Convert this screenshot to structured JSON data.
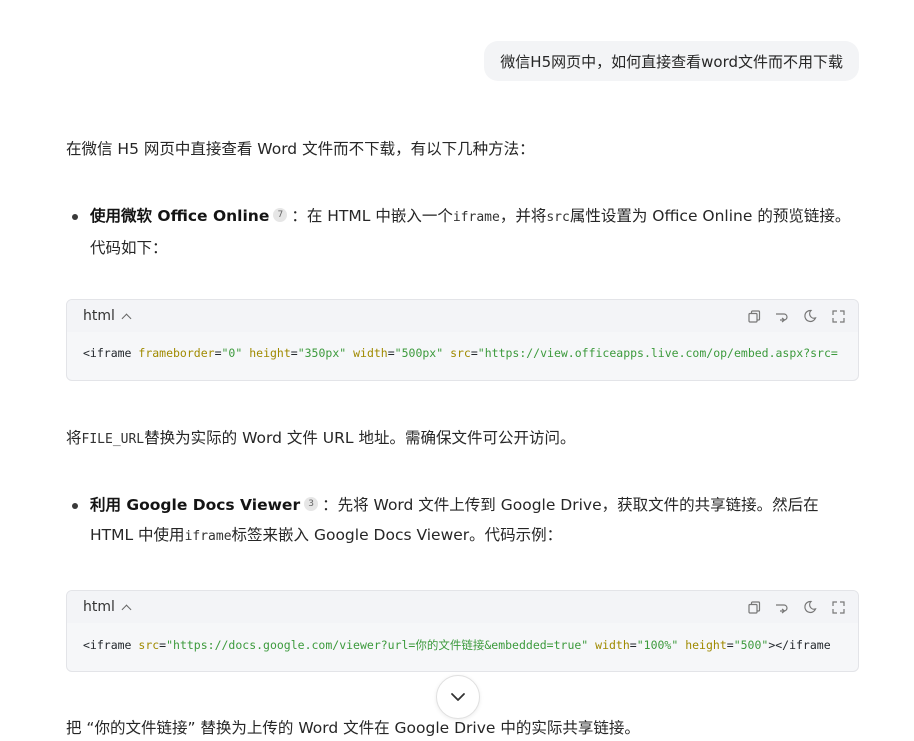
{
  "user_message": "微信H5网页中，如何直接查看word文件而不用下载",
  "intro": "在微信 H5 网页中直接查看 Word 文件而不下载，有以下几种方法：",
  "bullets": [
    {
      "title": "使用微软 Office Online",
      "cite": "7",
      "text_a": "：在 HTML 中嵌入一个",
      "code_a": "iframe",
      "text_b": "，并将",
      "code_b": "src",
      "text_c": "属性设置为 Office Online 的预览链接。代码如下："
    },
    {
      "title": "利用 Google Docs Viewer",
      "cite": "3",
      "text_a": "：先将 Word 文件上传到 Google Drive，获取文件的共享链接。然后在 HTML 中使用",
      "code_a": "iframe",
      "text_b": "标签来嵌入 Google Docs Viewer。代码示例："
    }
  ],
  "code_blocks": [
    {
      "lang": "html",
      "tokens": [
        {
          "t": "tag",
          "v": "<iframe "
        },
        {
          "t": "attr",
          "v": "frameborder"
        },
        {
          "t": "tag",
          "v": "="
        },
        {
          "t": "str",
          "v": "\"0\""
        },
        {
          "t": "tag",
          "v": " "
        },
        {
          "t": "attr",
          "v": "height"
        },
        {
          "t": "tag",
          "v": "="
        },
        {
          "t": "str",
          "v": "\"350px\""
        },
        {
          "t": "tag",
          "v": " "
        },
        {
          "t": "attr",
          "v": "width"
        },
        {
          "t": "tag",
          "v": "="
        },
        {
          "t": "str",
          "v": "\"500px\""
        },
        {
          "t": "tag",
          "v": " "
        },
        {
          "t": "attr",
          "v": "src"
        },
        {
          "t": "tag",
          "v": "="
        },
        {
          "t": "str",
          "v": "\"https://view.officeapps.live.com/op/embed.aspx?src="
        }
      ]
    },
    {
      "lang": "html",
      "tokens": [
        {
          "t": "tag",
          "v": "<iframe "
        },
        {
          "t": "attr",
          "v": "src"
        },
        {
          "t": "tag",
          "v": "="
        },
        {
          "t": "str",
          "v": "\"https://docs.google.com/viewer?url=你的文件链接&embedded=true\""
        },
        {
          "t": "tag",
          "v": " "
        },
        {
          "t": "attr",
          "v": "width"
        },
        {
          "t": "tag",
          "v": "="
        },
        {
          "t": "str",
          "v": "\"100%\""
        },
        {
          "t": "tag",
          "v": " "
        },
        {
          "t": "attr",
          "v": "height"
        },
        {
          "t": "tag",
          "v": "="
        },
        {
          "t": "str",
          "v": "\"500\""
        },
        {
          "t": "tag",
          "v": "></iframe"
        }
      ]
    }
  ],
  "para2": {
    "before": "将",
    "code": "FILE_URL",
    "after": "替换为实际的 Word 文件 URL 地址。需确保文件可公开访问。"
  },
  "para3": "把 “你的文件链接” 替换为上传的 Word 文件在 Google Drive 中的实际共享链接。",
  "icons": {
    "copy": "copy-icon",
    "wrap": "wrap-icon",
    "theme": "theme-icon",
    "expand": "expand-icon",
    "scroll": "chevron-down-icon"
  }
}
